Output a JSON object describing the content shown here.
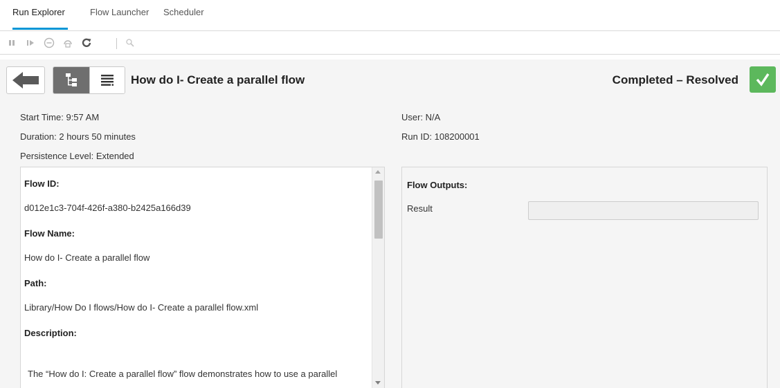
{
  "tabs": [
    {
      "label": "Run Explorer",
      "active": true
    },
    {
      "label": "Flow Launcher",
      "active": false
    },
    {
      "label": "Scheduler",
      "active": false
    }
  ],
  "toolbar": {
    "icons": [
      "pause-icon",
      "resume-icon",
      "cancel-icon",
      "reassign-icon",
      "refresh-icon",
      "zoom-icon"
    ]
  },
  "run": {
    "title": "How do I- Create a parallel flow",
    "status": "Completed – Resolved",
    "status_color": "#5cb85c",
    "start_time": "Start Time: 9:57 AM",
    "duration": "Duration: 2 hours 50 minutes",
    "persistence": "Persistence Level: Extended",
    "user": "User: N/A",
    "run_id": "Run ID: 108200001"
  },
  "details": {
    "flow_id_label": "Flow ID:",
    "flow_id_value": "d012e1c3-704f-426f-a380-b2425a166d39",
    "flow_name_label": "Flow Name:",
    "flow_name_value": "How do I- Create a parallel flow",
    "path_label": "Path:",
    "path_value": "Library/How Do I flows/How do I- Create a parallel flow.xml",
    "description_label": "Description:",
    "description_value": "The “How do I: Create a parallel flow” flow demonstrates how to use a parallel"
  },
  "outputs": {
    "label": "Flow Outputs:",
    "result_label": "Result",
    "result_value": ""
  },
  "colors": {
    "accent": "#0096d6",
    "success": "#5cb85c"
  }
}
